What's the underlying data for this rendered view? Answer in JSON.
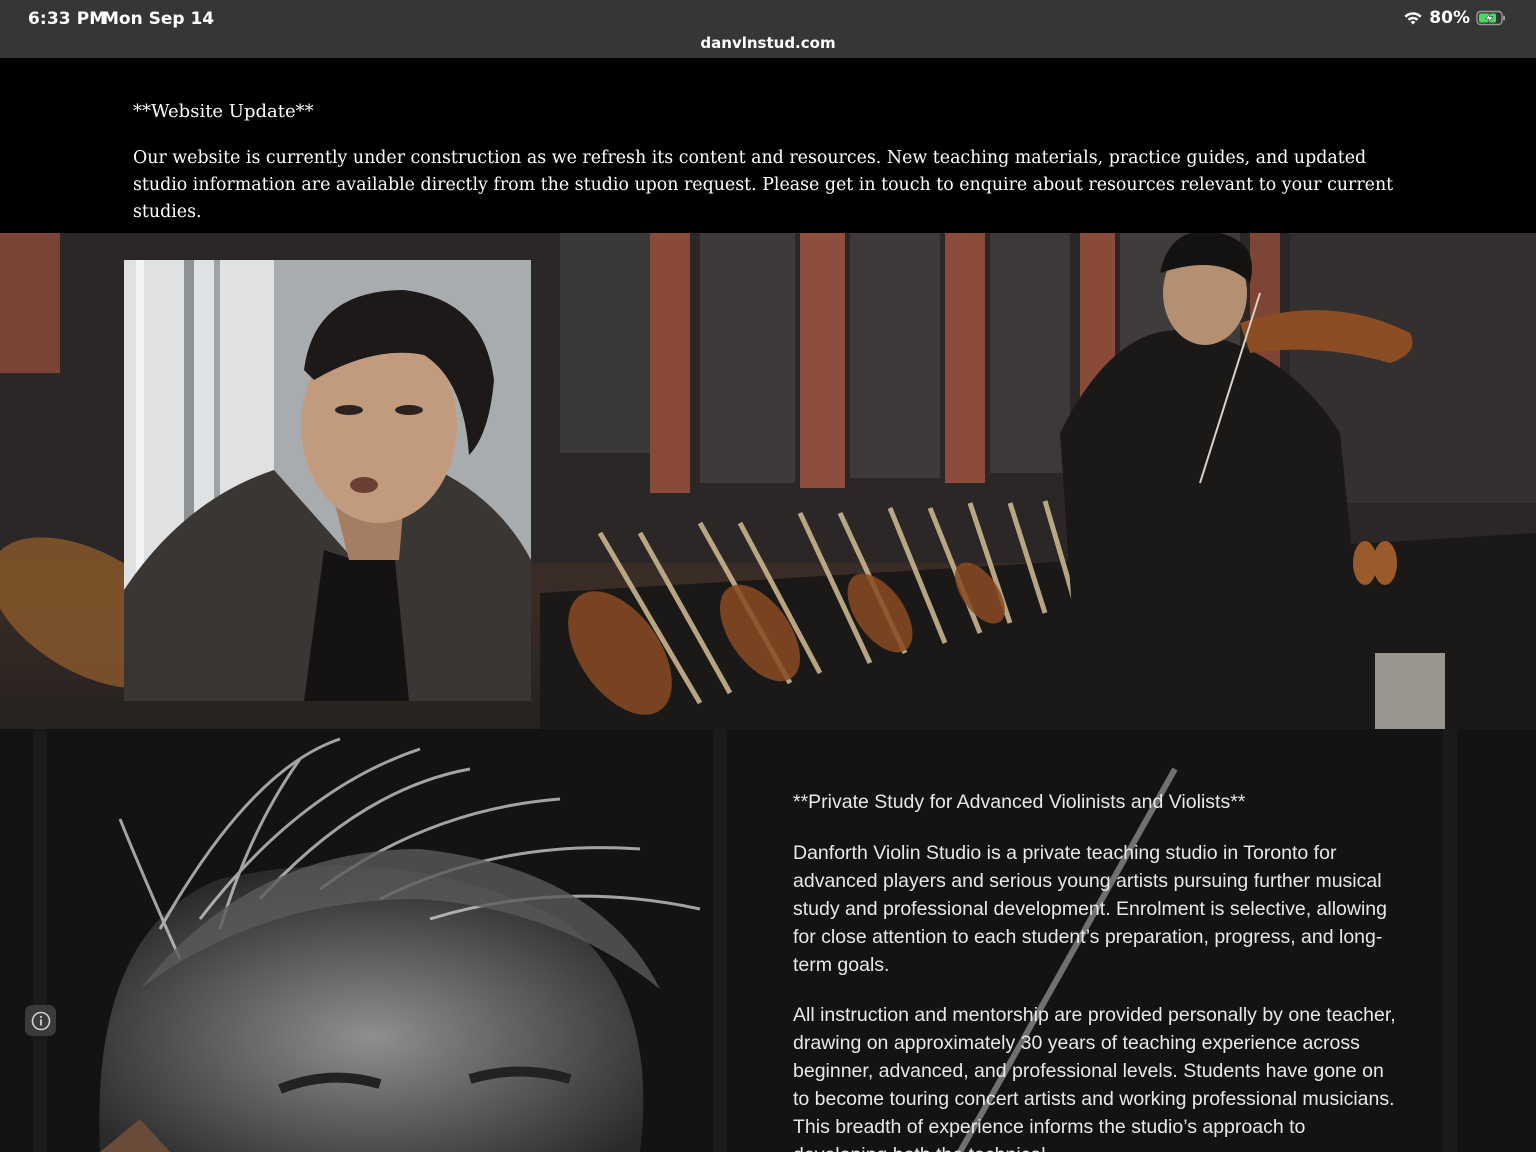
{
  "status_bar": {
    "time": "6:33 PM",
    "date": "Mon Sep 14",
    "battery_percent": "80%",
    "wifi_icon": "wifi-icon",
    "battery_icon": "battery-charging-icon"
  },
  "browser": {
    "url": "danvlnstud.com"
  },
  "update": {
    "title": "**Website Update**",
    "body": "Our website is currently under construction as we refresh its content and resources. New teaching materials, practice guides, and updated studio information are available directly from the studio upon request. Please get in touch to enquire about resources relevant to your current studies."
  },
  "hero": {
    "background_icon": "violinist-performing-photo",
    "portrait_icon": "teacher-portrait-photo"
  },
  "studio": {
    "heading": "**Private Study for Advanced Violinists and Violists**",
    "paragraph_1": "Danforth Violin Studio is a private teaching studio in Toronto for advanced players and serious young artists pursuing further musical study and professional development. Enrolment is selective, allowing for close attention to each student’s preparation, progress, and long-term goals.",
    "paragraph_2": "All instruction and mentorship are provided personally by one teacher, drawing on approximately 30 years of teaching experience across beginner, advanced, and professional levels. Students have gone on to become touring concert artists and working professional musicians. This breadth of experience informs the studio’s approach to developing both the technical"
  },
  "info_button_icon": "info-icon",
  "colors": {
    "status_bar_bg": "#353638",
    "page_bg": "#000000",
    "lower_bg": "#121214",
    "battery_green": "#4cd964"
  }
}
